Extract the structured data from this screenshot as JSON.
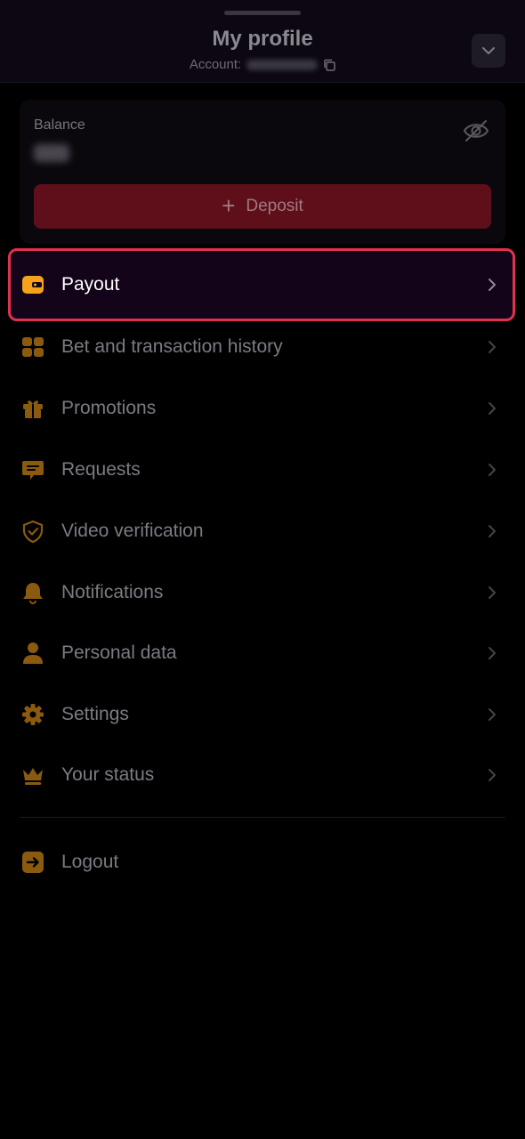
{
  "header": {
    "title": "My profile",
    "account_label": "Account:"
  },
  "balance": {
    "label": "Balance",
    "deposit_label": "Deposit"
  },
  "menu": [
    {
      "label": "Payout",
      "icon": "wallet-icon"
    },
    {
      "label": "Bet and transaction history",
      "icon": "history-icon"
    },
    {
      "label": "Promotions",
      "icon": "gift-icon"
    },
    {
      "label": "Requests",
      "icon": "chat-icon"
    },
    {
      "label": "Video verification",
      "icon": "shield-check-icon"
    },
    {
      "label": "Notifications",
      "icon": "bell-icon"
    },
    {
      "label": "Personal data",
      "icon": "user-icon"
    },
    {
      "label": "Settings",
      "icon": "gear-icon"
    },
    {
      "label": "Your status",
      "icon": "crown-icon"
    }
  ],
  "logout": {
    "label": "Logout",
    "icon": "logout-icon"
  },
  "colors": {
    "accent": "#f5a21b",
    "icon_dim": "#8a5a0e",
    "highlight_border": "#e0314e",
    "deposit_bg": "#5e0f1a",
    "background": "#000000"
  }
}
